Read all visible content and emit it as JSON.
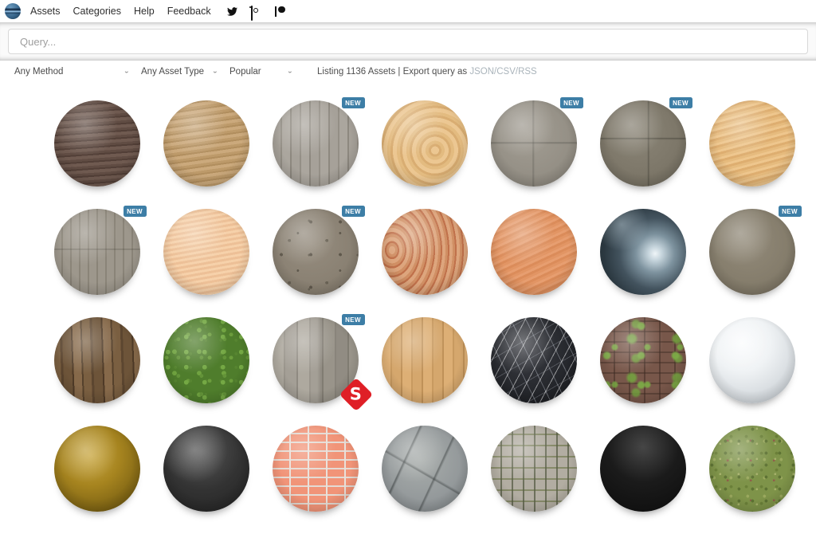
{
  "header": {
    "nav": [
      {
        "label": "Assets"
      },
      {
        "label": "Categories"
      },
      {
        "label": "Help"
      },
      {
        "label": "Feedback"
      }
    ]
  },
  "search": {
    "placeholder": "Query..."
  },
  "filter_bar": {
    "method": "Any Method",
    "asset_type": "Any Asset Type",
    "sort": "Popular",
    "listing_prefix": "Listing 1136 Assets | Export query as ",
    "export_links": "JSON/CSV/RSS"
  },
  "badge": {
    "new_label": "NEW"
  },
  "colors": {
    "badge_blue": "#3d7ea6",
    "substance_red": "#df1f26"
  },
  "grid": {
    "assets": [
      {
        "texture": "wood-dark",
        "new": false,
        "substance": false
      },
      {
        "texture": "wood-tan",
        "new": false,
        "substance": false
      },
      {
        "texture": "planks-gray",
        "new": true,
        "substance": false
      },
      {
        "texture": "wood-pine",
        "new": false,
        "substance": false
      },
      {
        "texture": "concrete-light",
        "new": true,
        "substance": false
      },
      {
        "texture": "concrete-dark",
        "new": true,
        "substance": false
      },
      {
        "texture": "wood-gold",
        "new": false,
        "substance": false
      },
      {
        "texture": "concrete-boards",
        "new": true,
        "substance": false
      },
      {
        "texture": "wood-peach",
        "new": false,
        "substance": false
      },
      {
        "texture": "concrete-spotty",
        "new": true,
        "substance": false
      },
      {
        "texture": "wood-swirl",
        "new": false,
        "substance": false
      },
      {
        "texture": "wood-orange",
        "new": false,
        "substance": false
      },
      {
        "texture": "metal-dark",
        "new": false,
        "substance": false
      },
      {
        "texture": "concrete-olive",
        "new": true,
        "substance": false
      },
      {
        "texture": "planks-darkwood",
        "new": false,
        "substance": false
      },
      {
        "texture": "moss",
        "new": false,
        "substance": false
      },
      {
        "texture": "planks-gray2",
        "new": true,
        "substance": true
      },
      {
        "texture": "planks-tan",
        "new": false,
        "substance": false
      },
      {
        "texture": "marble-black",
        "new": false,
        "substance": false
      },
      {
        "texture": "brick-moss",
        "new": false,
        "substance": false
      },
      {
        "texture": "plaster-white",
        "new": false,
        "substance": false
      },
      {
        "texture": "glass-amber",
        "new": false,
        "substance": false
      },
      {
        "texture": "rubber-black",
        "new": false,
        "substance": false
      },
      {
        "texture": "brick-salmon",
        "new": false,
        "substance": false
      },
      {
        "texture": "stone-slab",
        "new": false,
        "substance": false
      },
      {
        "texture": "cobblestone",
        "new": false,
        "substance": false
      },
      {
        "texture": "gloss-black",
        "new": false,
        "substance": false
      },
      {
        "texture": "ground-green",
        "new": false,
        "substance": false
      }
    ]
  }
}
